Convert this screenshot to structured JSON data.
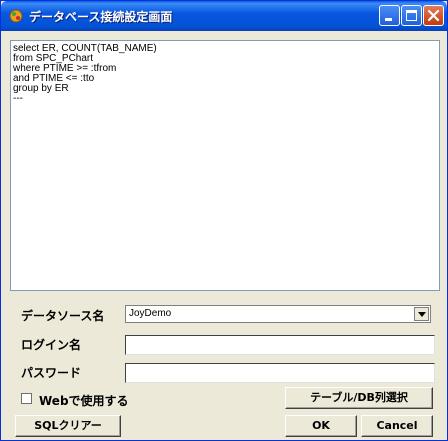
{
  "window": {
    "title": "データベース接続設定画面"
  },
  "sql": {
    "lines": [
      "select ER, COUNT(TAB_NAME)",
      "from SPC_PChart",
      "where PTIME >= :tfrom",
      "and PTIME <= :tto",
      "group by ER",
      "---"
    ]
  },
  "form": {
    "datasource_label": "データソース名",
    "datasource_value": "JoyDemo",
    "login_label": "ログイン名",
    "login_value": "",
    "password_label": "パスワード",
    "password_value": "",
    "web_checkbox_label": "Webで使用する",
    "web_checked": false
  },
  "buttons": {
    "table_db": "テーブル/DB列選択",
    "sql_clear": "SQLクリアー",
    "ok": "OK",
    "cancel": "Cancel"
  }
}
